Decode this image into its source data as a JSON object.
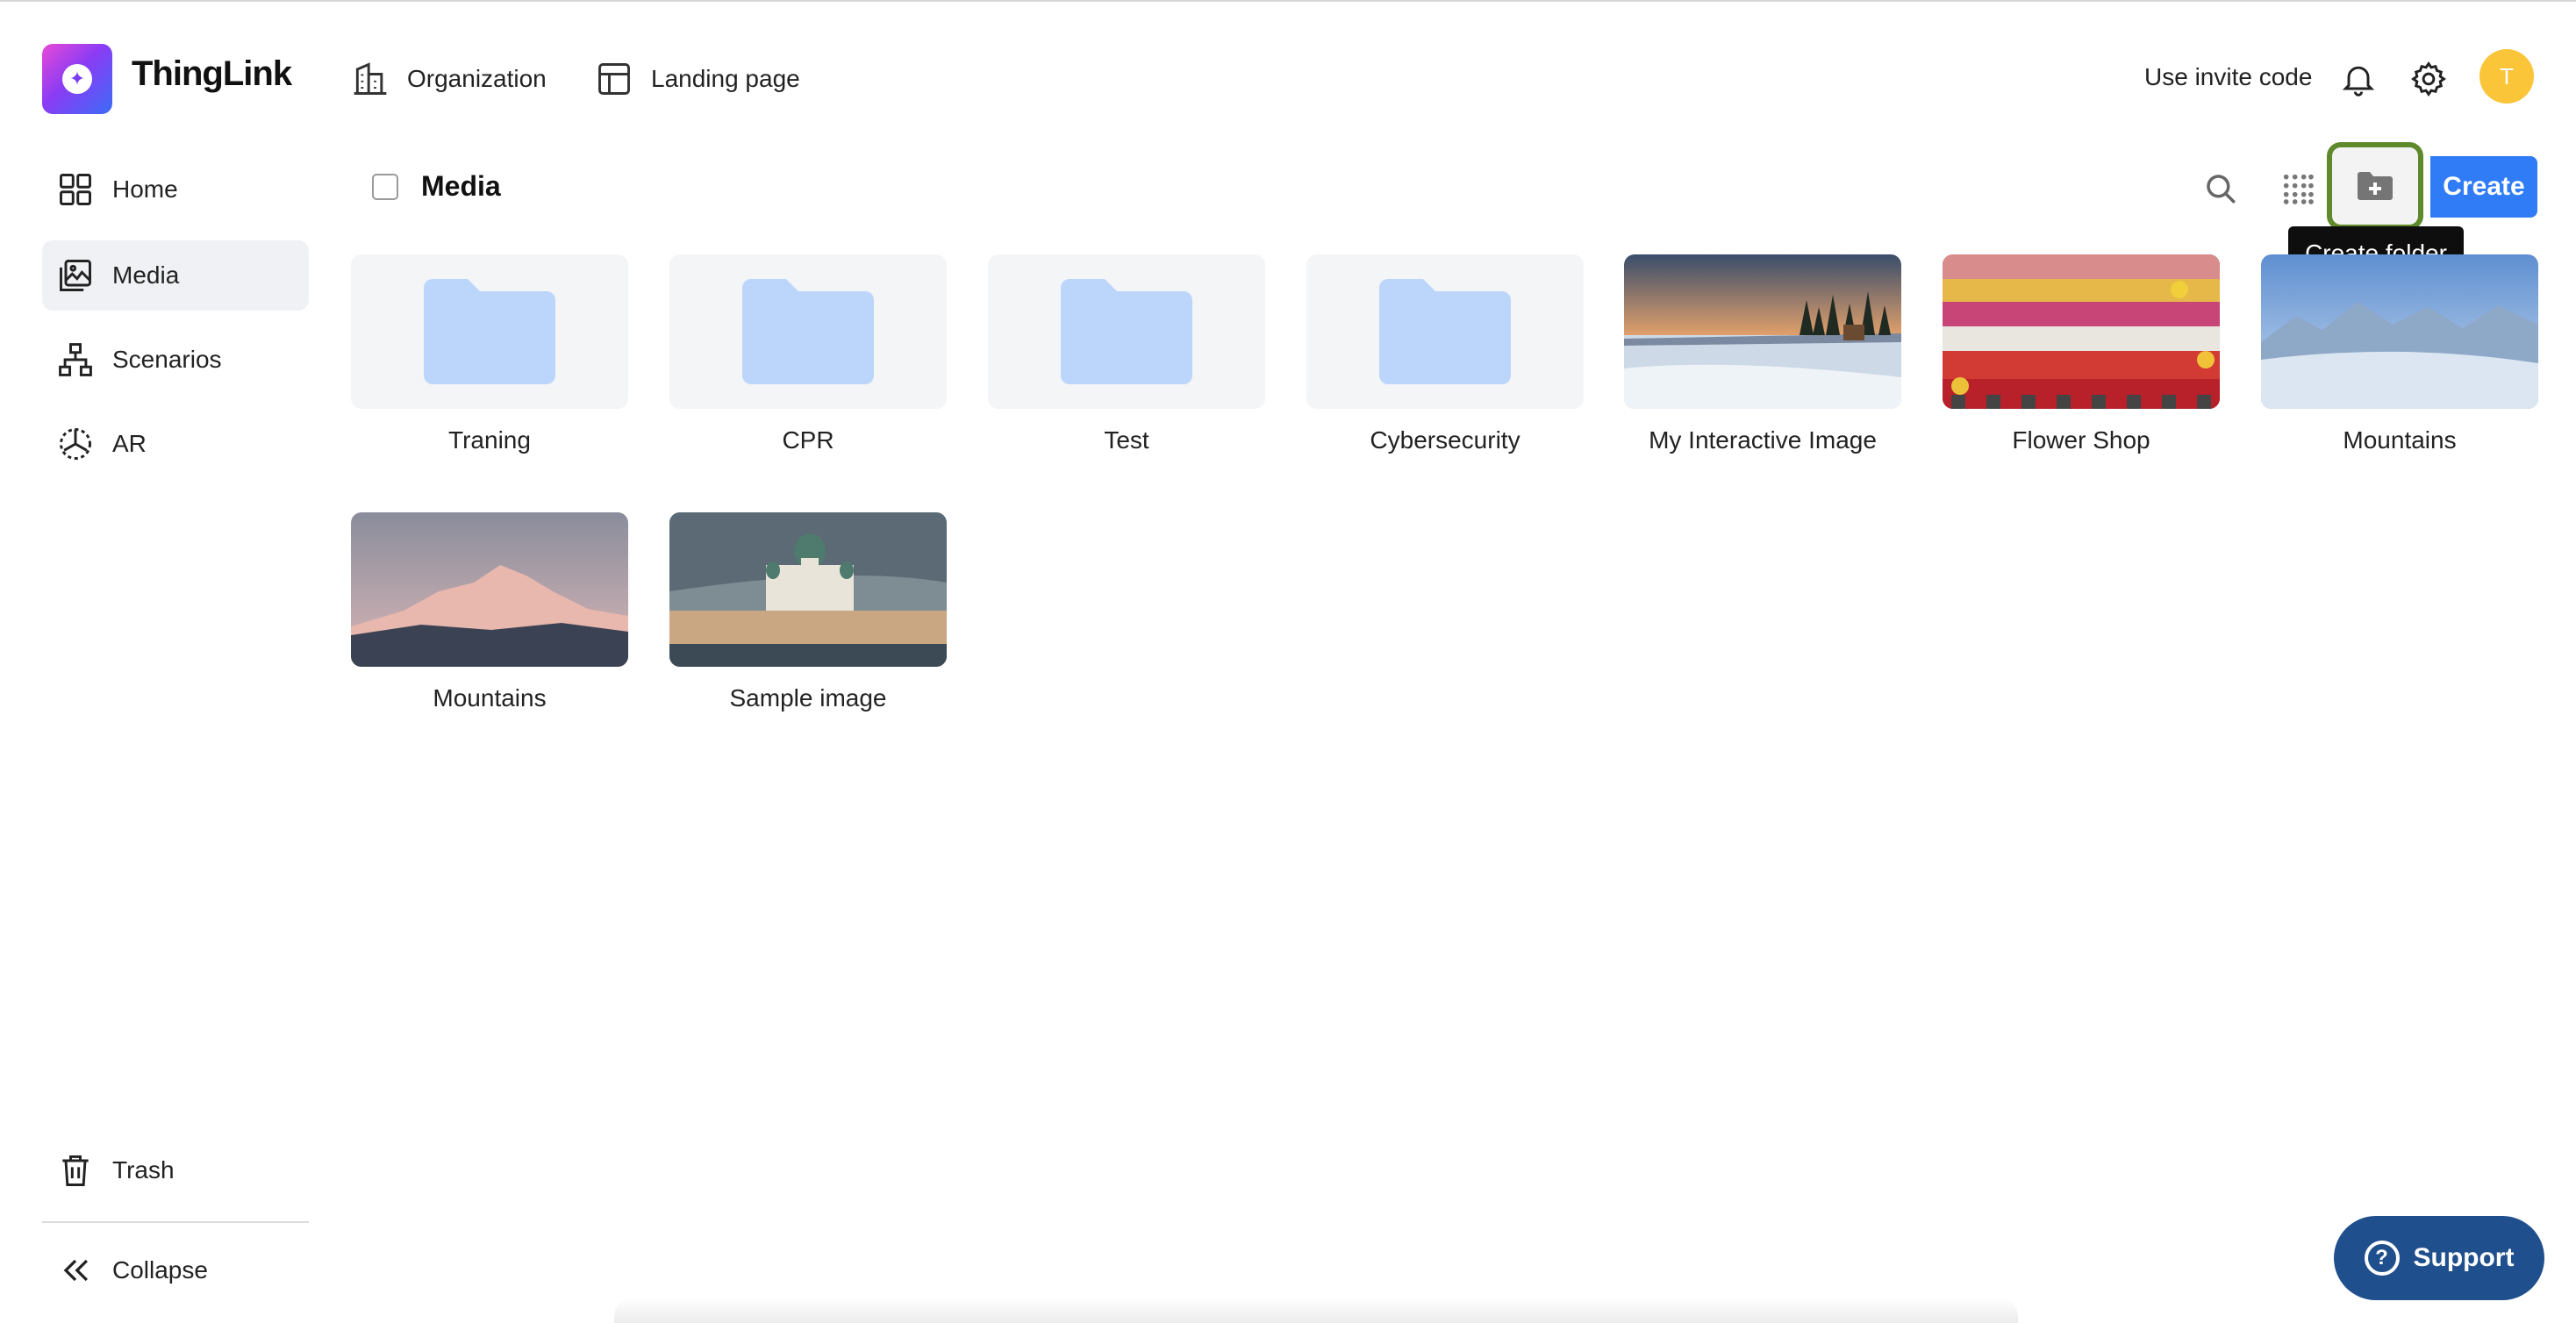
{
  "app": {
    "name": "ThingLink"
  },
  "header": {
    "organization_label": "Organization",
    "landing_page_label": "Landing page",
    "invite_code_label": "Use invite code",
    "avatar_initial": "T"
  },
  "sidebar": {
    "items": [
      {
        "label": "Home",
        "icon": "home-grid-icon",
        "active": false
      },
      {
        "label": "Media",
        "icon": "media-icon",
        "active": true
      },
      {
        "label": "Scenarios",
        "icon": "scenarios-icon",
        "active": false
      },
      {
        "label": "AR",
        "icon": "ar-icon",
        "active": false
      }
    ],
    "trash_label": "Trash",
    "collapse_label": "Collapse"
  },
  "main": {
    "title": "Media",
    "create_label": "Create",
    "tooltip": "Create folder",
    "items": [
      {
        "label": "Traning",
        "type": "folder"
      },
      {
        "label": "CPR",
        "type": "folder"
      },
      {
        "label": "Test",
        "type": "folder"
      },
      {
        "label": "Cybersecurity",
        "type": "folder"
      },
      {
        "label": "My Interactive Image",
        "type": "image",
        "scene": "winter-lake"
      },
      {
        "label": "Flower Shop",
        "type": "image",
        "scene": "flowers"
      },
      {
        "label": "Mountains",
        "type": "image",
        "scene": "blue-mountains"
      },
      {
        "label": "Mountains",
        "type": "image",
        "scene": "pink-mountains"
      },
      {
        "label": "Sample image",
        "type": "image",
        "scene": "cathedral"
      }
    ]
  },
  "support": {
    "label": "Support"
  },
  "colors": {
    "accent": "#2f7cf6",
    "highlight": "#5f8a2c",
    "folder": "#bcd6fb",
    "support": "#1f4f8c",
    "avatar": "#fbc53a"
  }
}
